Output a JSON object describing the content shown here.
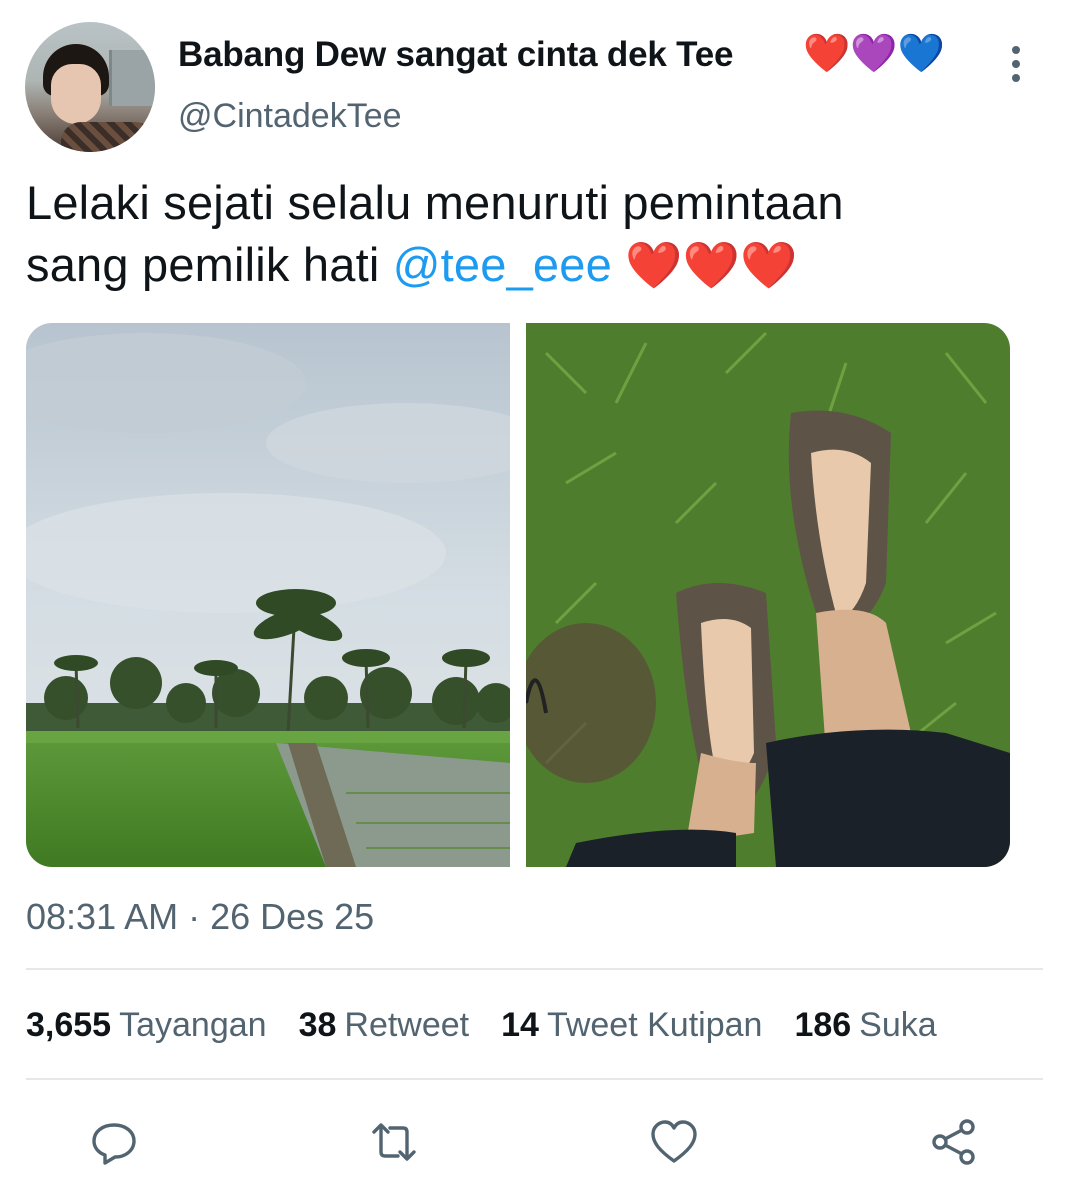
{
  "author": {
    "display_name": "Babang Dew sangat cinta dek Tee",
    "name_emoji": "❤️💜💙",
    "handle": "@CintadekTee"
  },
  "tweet": {
    "text_line1": "Lelaki sejati selalu menuruti pemintaan",
    "text_line2_prefix": "sang pemilik hati",
    "mention": "@tee_eee",
    "hearts": "❤️❤️❤️",
    "timestamp": "08:31 AM · 26 Des 25"
  },
  "stats": [
    {
      "value": "3,655",
      "label": "Tayangan"
    },
    {
      "value": "38",
      "label": "Retweet"
    },
    {
      "value": "14",
      "label": "Tweet Kutipan"
    },
    {
      "value": "186",
      "label": "Suka"
    }
  ],
  "media": [
    {
      "icon": "photo-rice-field",
      "alt_visible": ""
    },
    {
      "icon": "photo-muddy-feet",
      "alt_visible": ""
    }
  ],
  "actions": [
    "reply-icon",
    "retweet-icon",
    "like-icon",
    "share-icon"
  ],
  "colors": {
    "accent": "#1d9bf0",
    "text": "#0f1419",
    "secondary": "#536471",
    "divider": "#e4e8ea"
  }
}
